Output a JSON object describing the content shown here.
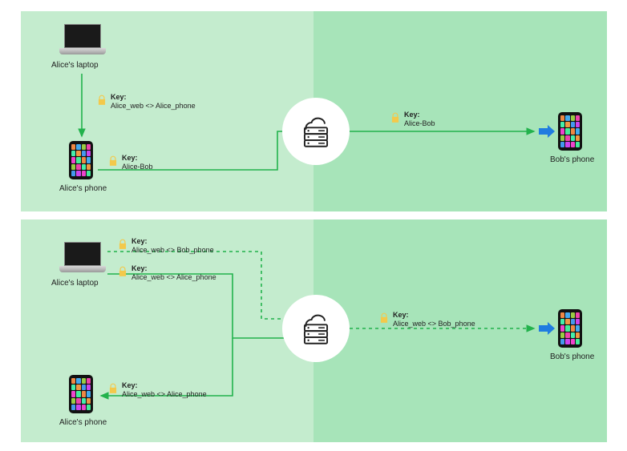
{
  "devices": {
    "alice_laptop": "Alice's laptop",
    "alice_phone": "Alice's phone",
    "bob_phone": "Bob's phone"
  },
  "keys": {
    "label": "Key:",
    "alice_web_alice_phone": "Alice_web <> Alice_phone",
    "alice_bob": "Alice-Bob",
    "alice_web_bob_phone": "Alice_web <> Bob_phone"
  },
  "colors": {
    "left_bg": "#c4ecce",
    "right_bg": "#a7e4b9",
    "arrow": "#22b24c",
    "arrow_blue": "#1f7ce0"
  }
}
